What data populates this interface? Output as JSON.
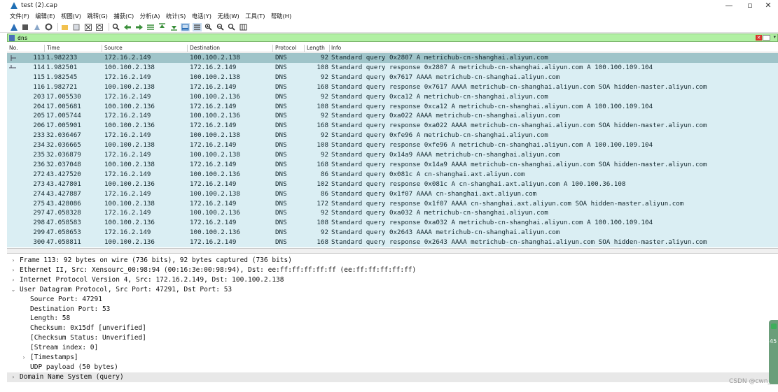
{
  "window": {
    "title": "test (2).cap"
  },
  "menu": [
    "文件(F)",
    "编辑(E)",
    "视图(V)",
    "跳转(G)",
    "捕获(C)",
    "分析(A)",
    "统计(S)",
    "电话(Y)",
    "无线(W)",
    "工具(T)",
    "帮助(H)"
  ],
  "filter": {
    "value": "dns"
  },
  "columns": [
    "No.",
    "Time",
    "Source",
    "Destination",
    "Protocol",
    "Length",
    "Info"
  ],
  "packets": [
    {
      "no": "113",
      "time": "1.982233",
      "src": "172.16.2.149",
      "dst": "100.100.2.138",
      "proto": "DNS",
      "len": "92",
      "info": "Standard query 0x2807 A metrichub-cn-shanghai.aliyun.com"
    },
    {
      "no": "114",
      "time": "1.982501",
      "src": "100.100.2.138",
      "dst": "172.16.2.149",
      "proto": "DNS",
      "len": "108",
      "info": "Standard query response 0x2807 A metrichub-cn-shanghai.aliyun.com A 100.100.109.104"
    },
    {
      "no": "115",
      "time": "1.982545",
      "src": "172.16.2.149",
      "dst": "100.100.2.138",
      "proto": "DNS",
      "len": "92",
      "info": "Standard query 0x7617 AAAA metrichub-cn-shanghai.aliyun.com"
    },
    {
      "no": "116",
      "time": "1.982721",
      "src": "100.100.2.138",
      "dst": "172.16.2.149",
      "proto": "DNS",
      "len": "168",
      "info": "Standard query response 0x7617 AAAA metrichub-cn-shanghai.aliyun.com SOA hidden-master.aliyun.com"
    },
    {
      "no": "203",
      "time": "17.005530",
      "src": "172.16.2.149",
      "dst": "100.100.2.136",
      "proto": "DNS",
      "len": "92",
      "info": "Standard query 0xca12 A metrichub-cn-shanghai.aliyun.com"
    },
    {
      "no": "204",
      "time": "17.005681",
      "src": "100.100.2.136",
      "dst": "172.16.2.149",
      "proto": "DNS",
      "len": "108",
      "info": "Standard query response 0xca12 A metrichub-cn-shanghai.aliyun.com A 100.100.109.104"
    },
    {
      "no": "205",
      "time": "17.005744",
      "src": "172.16.2.149",
      "dst": "100.100.2.136",
      "proto": "DNS",
      "len": "92",
      "info": "Standard query 0xa022 AAAA metrichub-cn-shanghai.aliyun.com"
    },
    {
      "no": "206",
      "time": "17.005901",
      "src": "100.100.2.136",
      "dst": "172.16.2.149",
      "proto": "DNS",
      "len": "168",
      "info": "Standard query response 0xa022 AAAA metrichub-cn-shanghai.aliyun.com SOA hidden-master.aliyun.com"
    },
    {
      "no": "233",
      "time": "32.036467",
      "src": "172.16.2.149",
      "dst": "100.100.2.138",
      "proto": "DNS",
      "len": "92",
      "info": "Standard query 0xfe96 A metrichub-cn-shanghai.aliyun.com"
    },
    {
      "no": "234",
      "time": "32.036665",
      "src": "100.100.2.138",
      "dst": "172.16.2.149",
      "proto": "DNS",
      "len": "108",
      "info": "Standard query response 0xfe96 A metrichub-cn-shanghai.aliyun.com A 100.100.109.104"
    },
    {
      "no": "235",
      "time": "32.036879",
      "src": "172.16.2.149",
      "dst": "100.100.2.138",
      "proto": "DNS",
      "len": "92",
      "info": "Standard query 0x14a9 AAAA metrichub-cn-shanghai.aliyun.com"
    },
    {
      "no": "236",
      "time": "32.037048",
      "src": "100.100.2.138",
      "dst": "172.16.2.149",
      "proto": "DNS",
      "len": "168",
      "info": "Standard query response 0x14a9 AAAA metrichub-cn-shanghai.aliyun.com SOA hidden-master.aliyun.com"
    },
    {
      "no": "272",
      "time": "43.427520",
      "src": "172.16.2.149",
      "dst": "100.100.2.136",
      "proto": "DNS",
      "len": "86",
      "info": "Standard query 0x081c A cn-shanghai.axt.aliyun.com"
    },
    {
      "no": "273",
      "time": "43.427801",
      "src": "100.100.2.136",
      "dst": "172.16.2.149",
      "proto": "DNS",
      "len": "102",
      "info": "Standard query response 0x081c A cn-shanghai.axt.aliyun.com A 100.100.36.108"
    },
    {
      "no": "274",
      "time": "43.427887",
      "src": "172.16.2.149",
      "dst": "100.100.2.138",
      "proto": "DNS",
      "len": "86",
      "info": "Standard query 0x1f07 AAAA cn-shanghai.axt.aliyun.com"
    },
    {
      "no": "275",
      "time": "43.428086",
      "src": "100.100.2.138",
      "dst": "172.16.2.149",
      "proto": "DNS",
      "len": "172",
      "info": "Standard query response 0x1f07 AAAA cn-shanghai.axt.aliyun.com SOA hidden-master.aliyun.com"
    },
    {
      "no": "297",
      "time": "47.058328",
      "src": "172.16.2.149",
      "dst": "100.100.2.136",
      "proto": "DNS",
      "len": "92",
      "info": "Standard query 0xa032 A metrichub-cn-shanghai.aliyun.com"
    },
    {
      "no": "298",
      "time": "47.058583",
      "src": "100.100.2.136",
      "dst": "172.16.2.149",
      "proto": "DNS",
      "len": "108",
      "info": "Standard query response 0xa032 A metrichub-cn-shanghai.aliyun.com A 100.100.109.104"
    },
    {
      "no": "299",
      "time": "47.058653",
      "src": "172.16.2.149",
      "dst": "100.100.2.136",
      "proto": "DNS",
      "len": "92",
      "info": "Standard query 0x2643 AAAA metrichub-cn-shanghai.aliyun.com"
    },
    {
      "no": "300",
      "time": "47.058811",
      "src": "100.100.2.136",
      "dst": "172.16.2.149",
      "proto": "DNS",
      "len": "168",
      "info": "Standard query response 0x2643 AAAA metrichub-cn-shanghai.aliyun.com SOA hidden-master.aliyun.com"
    }
  ],
  "details": [
    {
      "arrow": ">",
      "indent": 0,
      "text": "Frame 113: 92 bytes on wire (736 bits), 92 bytes captured (736 bits)"
    },
    {
      "arrow": ">",
      "indent": 0,
      "text": "Ethernet II, Src: Xensourc_00:98:94 (00:16:3e:00:98:94), Dst: ee:ff:ff:ff:ff:ff (ee:ff:ff:ff:ff:ff)"
    },
    {
      "arrow": ">",
      "indent": 0,
      "text": "Internet Protocol Version 4, Src: 172.16.2.149, Dst: 100.100.2.138"
    },
    {
      "arrow": "v",
      "indent": 0,
      "text": "User Datagram Protocol, Src Port: 47291, Dst Port: 53"
    },
    {
      "arrow": "",
      "indent": 1,
      "text": "Source Port: 47291"
    },
    {
      "arrow": "",
      "indent": 1,
      "text": "Destination Port: 53"
    },
    {
      "arrow": "",
      "indent": 1,
      "text": "Length: 58"
    },
    {
      "arrow": "",
      "indent": 1,
      "text": "Checksum: 0x15df [unverified]"
    },
    {
      "arrow": "",
      "indent": 1,
      "text": "[Checksum Status: Unverified]"
    },
    {
      "arrow": "",
      "indent": 1,
      "text": "[Stream index: 0]"
    },
    {
      "arrow": ">",
      "indent": 1,
      "text": "[Timestamps]"
    },
    {
      "arrow": "",
      "indent": 1,
      "text": "UDP payload (50 bytes)"
    },
    {
      "arrow": ">",
      "indent": 0,
      "text": "Domain Name System (query)"
    }
  ],
  "side_widget": {
    "number": "45"
  },
  "watermark": "CSDN @cwn_",
  "colors": {
    "row_bg": "#daeef3",
    "row_selected": "#9fc4c9",
    "filter_bg": "#b1f0a3"
  }
}
